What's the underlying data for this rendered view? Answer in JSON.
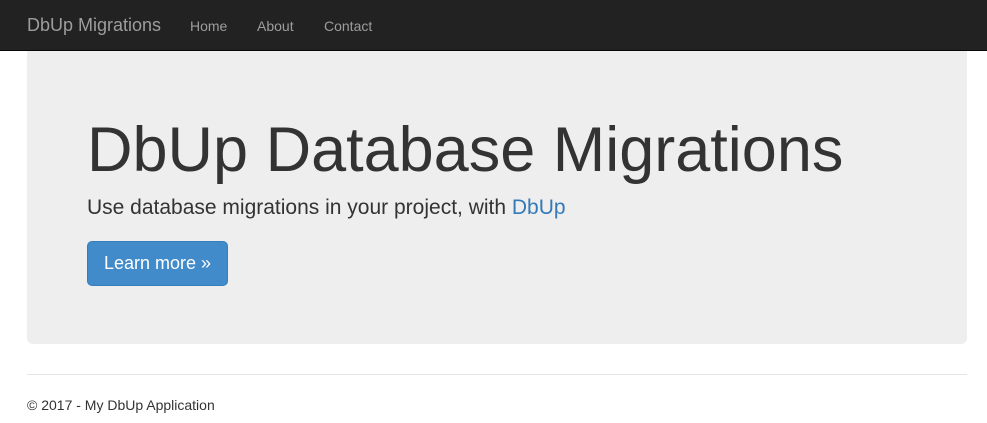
{
  "navbar": {
    "brand": "DbUp Migrations",
    "links": [
      {
        "label": "Home"
      },
      {
        "label": "About"
      },
      {
        "label": "Contact"
      }
    ]
  },
  "jumbotron": {
    "title": "DbUp Database Migrations",
    "lead_text": "Use database migrations in your project, with ",
    "lead_link": "DbUp",
    "button_label": "Learn more »"
  },
  "footer": {
    "text": "© 2017 - My DbUp Application"
  },
  "colors": {
    "navbar_bg": "#222222",
    "nav_text": "#9d9d9d",
    "jumbotron_bg": "#eeeeee",
    "link": "#337ab7",
    "button_bg": "#428bca"
  }
}
